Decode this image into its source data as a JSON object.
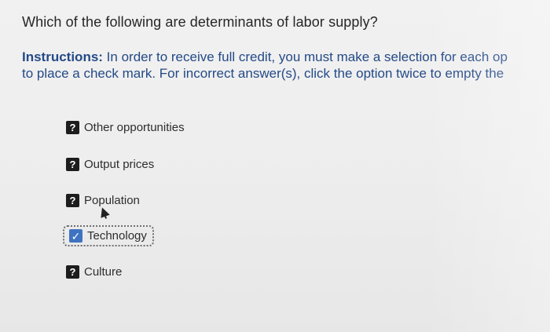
{
  "question": "Which of the following are determinants of labor supply?",
  "instructions": {
    "lead": "Instructions:",
    "line1_rest": " In order to receive full credit, you must make a selection for each op",
    "line2": "to place a check mark. For incorrect answer(s), click the option twice to empty the"
  },
  "options": [
    {
      "label": "Other opportunities",
      "state": "unknown",
      "icon": "question-mark-icon"
    },
    {
      "label": "Output prices",
      "state": "unknown",
      "icon": "question-mark-icon"
    },
    {
      "label": "Population",
      "state": "unknown",
      "icon": "question-mark-icon"
    },
    {
      "label": "Technology",
      "state": "checked",
      "icon": "check-icon"
    },
    {
      "label": "Culture",
      "state": "unknown",
      "icon": "question-mark-icon"
    }
  ],
  "colors": {
    "accent": "#3f73c1",
    "instruction_text": "#244a87",
    "unknown_badge": "#1d1d1d"
  }
}
